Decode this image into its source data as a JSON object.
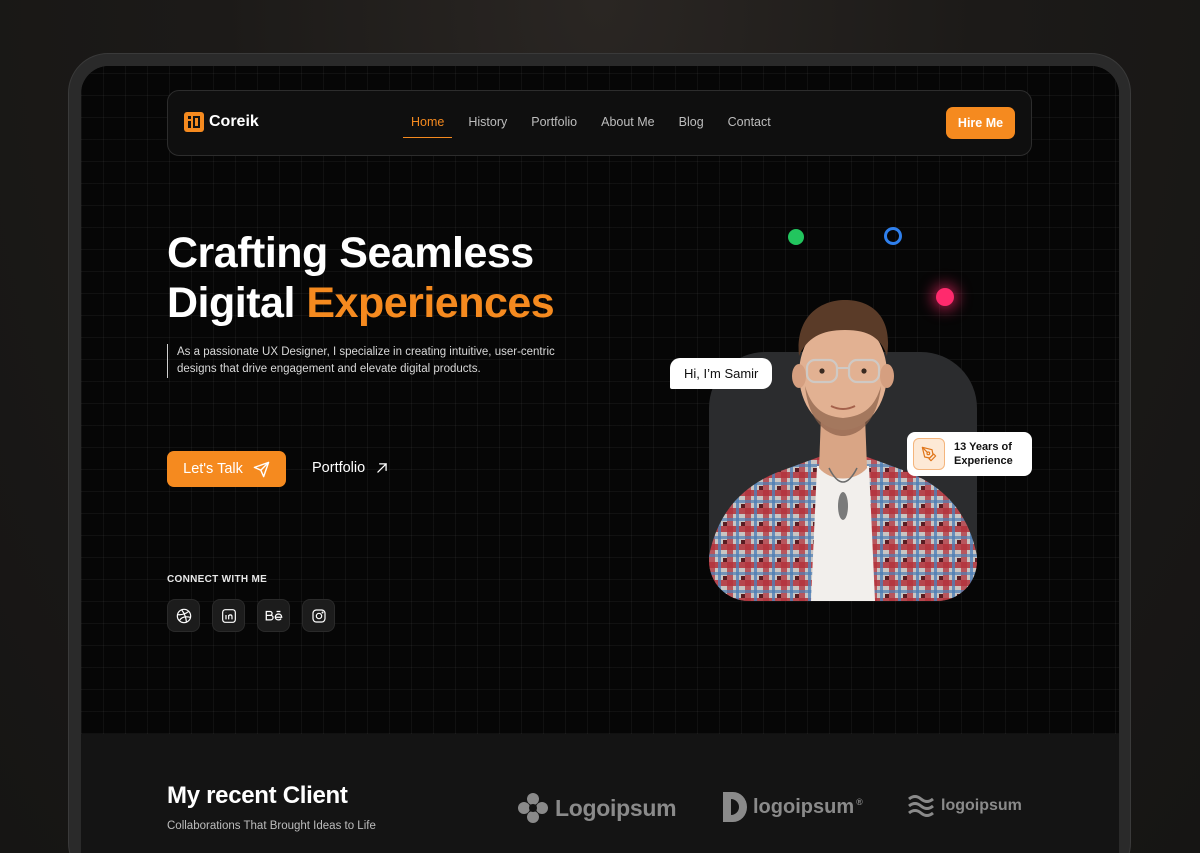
{
  "brand": {
    "name": "Coreik",
    "accent_color": "#f58a1f"
  },
  "nav": {
    "links": [
      "Home",
      "History",
      "Portfolio",
      "About Me",
      "Blog",
      "Contact"
    ],
    "active": "Home",
    "hire_label": "Hire Me"
  },
  "hero": {
    "headline_line1": "Crafting Seamless",
    "headline_line2_plain": "Digital ",
    "headline_line2_accent": "Experiences",
    "description": "As a passionate UX Designer, I specialize in creating intuitive, user-centric designs that drive engagement and elevate digital products.",
    "cta_primary": "Let's Talk",
    "cta_secondary": "Portfolio",
    "connect_label": "CONNECT WITH ME",
    "socials": [
      "dribbble-icon",
      "linkedin-icon",
      "behance-icon",
      "instagram-icon"
    ],
    "greeting": "Hi, I’m Samir",
    "experience_line1": "13 Years of",
    "experience_line2": "Experience"
  },
  "clients": {
    "title": "My recent Client",
    "subtitle": "Collaborations That Brought Ideas to Life",
    "logos": [
      "Logoipsum",
      "logoipsum",
      "logoipsum"
    ]
  }
}
